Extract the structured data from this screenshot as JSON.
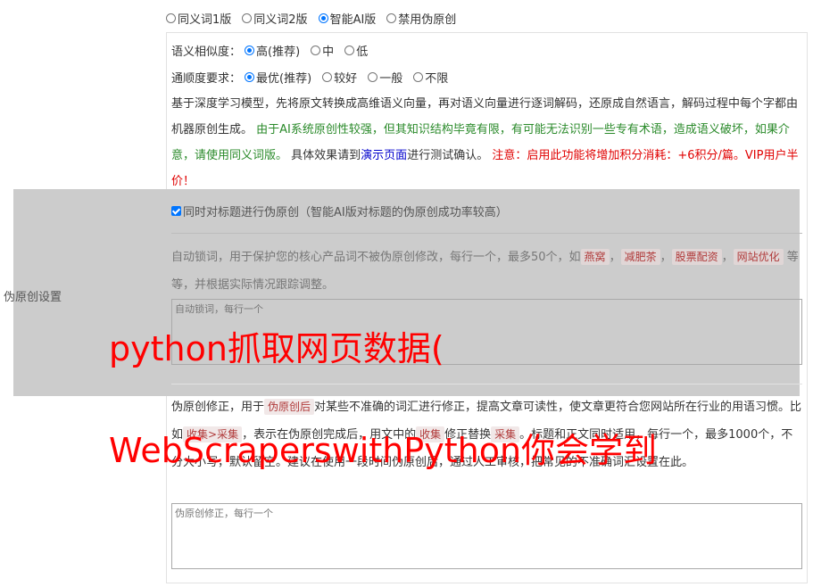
{
  "mode": {
    "options": [
      "同义词1版",
      "同义词2版",
      "智能AI版",
      "禁用伪原创"
    ],
    "selected_index": 2
  },
  "row_label": "伪原创设置",
  "similarity": {
    "label": "语义相似度：",
    "options": [
      "高(推荐)",
      "中",
      "低"
    ],
    "selected_index": 0
  },
  "fluency": {
    "label": "通顺度要求：",
    "options": [
      "最优(推荐)",
      "较好",
      "一般",
      "不限"
    ],
    "selected_index": 0
  },
  "description": {
    "part1": "基于深度学习模型，先将原文转换成高维语义向量，再对语义向量进行逐词解码，还原成自然语言，解码过程中每个字都由机器原创生成。",
    "part2_green": "由于AI系统原创性较强，但其知识结构毕竟有限，有可能无法识别一些专有术语，造成语义破坏，如果介意，请使用同义词版。",
    "part3": "具体效果请到",
    "link": "演示页面",
    "part4": "进行测试确认。",
    "warning_red": "注意：启用此功能将增加积分消耗：+6积分/篇。VIP用户半价！"
  },
  "title_checkbox": {
    "label": "同时对标题进行伪原创（智能AI版对标题的伪原创成功率较高）",
    "checked": true
  },
  "lock_words": {
    "text_before": "自动锁词，用于保护您的核心产品词不被伪原创修改，每行一个，最多50个，如",
    "examples": [
      "燕窝",
      "减肥茶",
      "股票配资",
      "网站优化"
    ],
    "text_after": "等等，并根据实际情况跟踪调整。",
    "placeholder": "自动锁词，每行一个"
  },
  "correction": {
    "text1": "伪原创修正，用于",
    "tag1": "伪原创后",
    "text2": "对某些不准确的词汇进行修正，提高文章可读性，使文章更符合您网站所在行业的用语习惯。比如",
    "tag2": "收集>采集",
    "text3": "，表示在伪原创完成后，用文中的",
    "tag3": "收集",
    "text4": "修正替换",
    "tag4": "采集",
    "text5": "。标题和正文同时适用，每行一个，最多1000个，不分大小写，默认留空。建议在使用一段时间伪原创后，通过人工审核，把常见的不准确词汇设置在此。",
    "placeholder": "伪原创修正，每行一个"
  },
  "watermark": {
    "line1": "python抓取网页数据(",
    "line2": "WebScraperswithPython你会学到"
  }
}
